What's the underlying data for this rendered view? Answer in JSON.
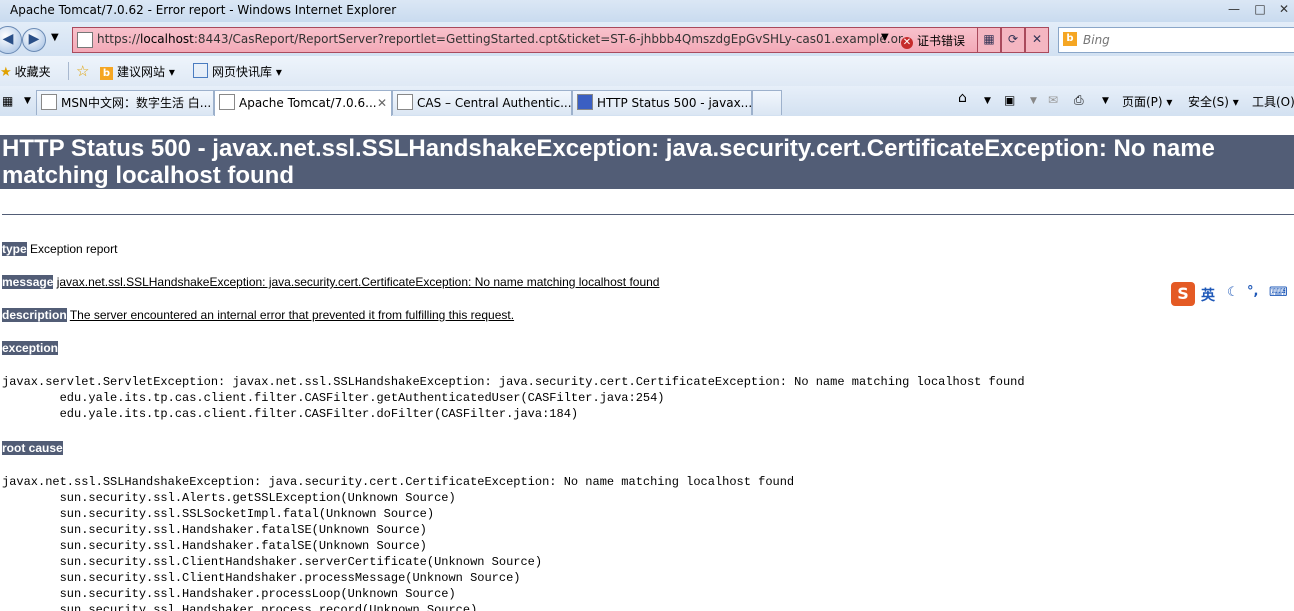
{
  "window": {
    "title": "Apache Tomcat/7.0.62 - Error report - Windows Internet Explorer"
  },
  "address": {
    "scheme": "https://",
    "host": "localhost",
    "rest": ":8443/CasReport/ReportServer?reportlet=GettingStarted.cpt&ticket=ST-6-jhbbb4QmszdgEpGvSHLy-cas01.example.or",
    "cert_error": "证书错误"
  },
  "search": {
    "placeholder": "Bing"
  },
  "favorites": {
    "label": "收藏夹",
    "items": [
      "建议网站 ▾",
      "网页快讯库 ▾"
    ]
  },
  "tabs": [
    {
      "label": "MSN中文网：数字生活 白..."
    },
    {
      "label": "Apache Tomcat/7.0.6..."
    },
    {
      "label": "CAS – Central Authentic..."
    },
    {
      "label": "HTTP Status 500 - javax...."
    }
  ],
  "commands": {
    "page": "页面(P) ▾",
    "safety": "安全(S) ▾",
    "tools": "工具(O)"
  },
  "ime": {
    "lang": "英"
  },
  "page": {
    "heading": "HTTP Status 500 - javax.net.ssl.SSLHandshakeException: java.security.cert.CertificateException: No name matching localhost found",
    "type_label": "type",
    "type_value": " Exception report",
    "message_label": "message",
    "message_value": "javax.net.ssl.SSLHandshakeException: java.security.cert.CertificateException: No name matching localhost found",
    "description_label": "description",
    "description_value": "The server encountered an internal error that prevented it from fulfilling this request.",
    "exception_label": "exception",
    "exception_trace": "javax.servlet.ServletException: javax.net.ssl.SSLHandshakeException: java.security.cert.CertificateException: No name matching localhost found\n\tedu.yale.its.tp.cas.client.filter.CASFilter.getAuthenticatedUser(CASFilter.java:254)\n\tedu.yale.its.tp.cas.client.filter.CASFilter.doFilter(CASFilter.java:184)",
    "root_cause_label": "root cause",
    "root_cause_trace": "javax.net.ssl.SSLHandshakeException: java.security.cert.CertificateException: No name matching localhost found\n\tsun.security.ssl.Alerts.getSSLException(Unknown Source)\n\tsun.security.ssl.SSLSocketImpl.fatal(Unknown Source)\n\tsun.security.ssl.Handshaker.fatalSE(Unknown Source)\n\tsun.security.ssl.Handshaker.fatalSE(Unknown Source)\n\tsun.security.ssl.ClientHandshaker.serverCertificate(Unknown Source)\n\tsun.security.ssl.ClientHandshaker.processMessage(Unknown Source)\n\tsun.security.ssl.Handshaker.processLoop(Unknown Source)\n\tsun.security.ssl.Handshaker.process_record(Unknown Source)"
  }
}
